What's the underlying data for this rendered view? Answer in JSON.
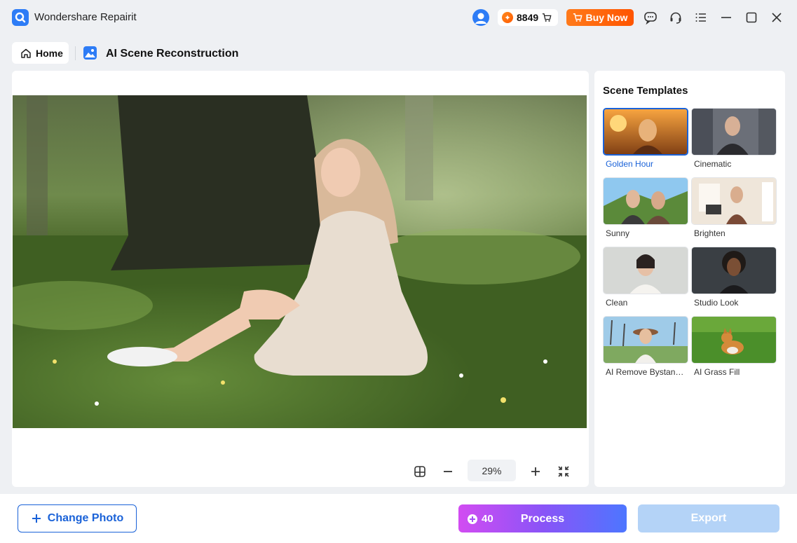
{
  "app": {
    "title": "Wondershare Repairit"
  },
  "header": {
    "credits": "8849",
    "buy_label": "Buy Now"
  },
  "nav": {
    "home_label": "Home",
    "page_title": "AI Scene Reconstruction"
  },
  "canvas": {
    "zoom": "29%"
  },
  "templates": {
    "title": "Scene Templates",
    "items": [
      {
        "label": "Golden Hour",
        "selected": true
      },
      {
        "label": "Cinematic",
        "selected": false
      },
      {
        "label": "Sunny",
        "selected": false
      },
      {
        "label": "Brighten",
        "selected": false
      },
      {
        "label": "Clean",
        "selected": false
      },
      {
        "label": "Studio Look",
        "selected": false
      },
      {
        "label": "AI Remove Bystand...",
        "selected": false
      },
      {
        "label": "AI Grass Fill",
        "selected": false
      }
    ]
  },
  "footer": {
    "change_photo_label": "Change Photo",
    "process_cost": "40",
    "process_label": "Process",
    "export_label": "Export"
  },
  "colors": {
    "accent": "#1a62d8",
    "buy": "#ff6a00",
    "process_start": "#d24cf2",
    "process_end": "#4d76ff",
    "export_disabled": "#b4d3f7"
  }
}
